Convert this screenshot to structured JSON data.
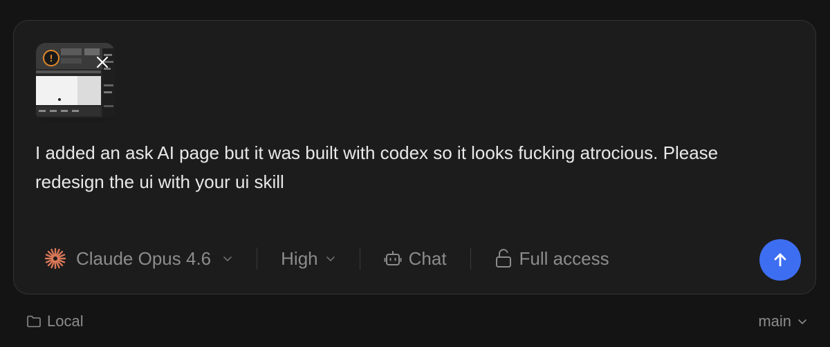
{
  "composer": {
    "attachment": {
      "icon": "screenshot-thumbnail",
      "warning_icon": "warning-icon",
      "remove_icon": "close-icon",
      "warning_color": "#e0892b"
    },
    "message": "I added an ask AI page but it was built with codex so it looks fucking atrocious. Please redesign the ui with your ui skill",
    "toolbar": {
      "model": {
        "label": "Claude Opus 4.6",
        "icon": "claude-sparkle-icon",
        "icon_color": "#d97757"
      },
      "effort": {
        "label": "High"
      },
      "mode": {
        "label": "Chat",
        "icon": "robot-icon"
      },
      "access": {
        "label": "Full access",
        "icon": "unlock-icon"
      }
    },
    "send": {
      "icon": "arrow-up-icon",
      "color": "#3d6ef2"
    }
  },
  "footer": {
    "location": {
      "label": "Local",
      "icon": "folder-icon"
    },
    "branch": {
      "label": "main"
    }
  }
}
